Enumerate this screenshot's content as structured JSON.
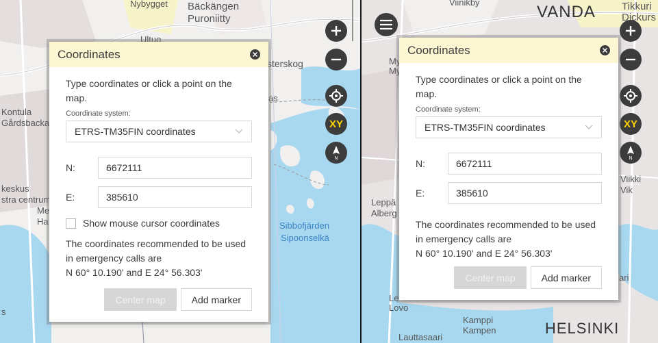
{
  "map_left": {
    "labels": [
      {
        "text": "Nybygget",
        "name": "map-label-nybygget"
      },
      {
        "text": "Bäckängen",
        "name": "map-label-backangen"
      },
      {
        "text": "Puroniitty",
        "name": "map-label-puroniitty"
      },
      {
        "text": "Ultuo",
        "name": "map-label-ultuo"
      },
      {
        "text": "sterskog",
        "name": "map-label-sterskog"
      },
      {
        "text": "as",
        "name": "map-label-as"
      },
      {
        "text": "Kontula",
        "name": "map-label-kontula"
      },
      {
        "text": "Gårdsbacka",
        "name": "map-label-gardsbacka"
      },
      {
        "text": "keskus",
        "name": "map-label-keskus"
      },
      {
        "text": "stra centrum",
        "name": "map-label-stra-centrum"
      },
      {
        "text": "Me",
        "name": "map-label-me"
      },
      {
        "text": "Ha",
        "name": "map-label-ha"
      },
      {
        "text": "Sibbofjärden",
        "name": "map-label-sibbofjarden"
      },
      {
        "text": "Sipoonselkä",
        "name": "map-label-sipoonselka"
      },
      {
        "text": "s",
        "name": "map-label-s"
      }
    ]
  },
  "map_right": {
    "labels": [
      {
        "text": "Viinikby",
        "name": "map-label-viinikby"
      },
      {
        "text": "VANDA",
        "name": "map-label-vanda"
      },
      {
        "text": "Tikkuri",
        "name": "map-label-tikkuri"
      },
      {
        "text": "Dickurs",
        "name": "map-label-dickurs"
      },
      {
        "text": "My",
        "name": "map-label-my"
      },
      {
        "text": "My",
        "name": "map-label-my-2"
      },
      {
        "text": "Leppä",
        "name": "map-label-leppa"
      },
      {
        "text": "Alberg",
        "name": "map-label-alberg"
      },
      {
        "text": "Viikki",
        "name": "map-label-viikki"
      },
      {
        "text": "Vik",
        "name": "map-label-vik"
      },
      {
        "text": "Le",
        "name": "map-label-le"
      },
      {
        "text": "Lovo",
        "name": "map-label-lovo"
      },
      {
        "text": "Kamppi",
        "name": "map-label-kamppi"
      },
      {
        "text": "Kampen",
        "name": "map-label-kampen"
      },
      {
        "text": "Lauttasaari",
        "name": "map-label-lauttasaari"
      },
      {
        "text": "HELSINKI",
        "name": "map-label-helsinki"
      },
      {
        "text": "ari",
        "name": "map-label-ari"
      }
    ]
  },
  "controls": {
    "zoom_in_label": "+",
    "zoom_out_label": "−",
    "xy_label": "XY",
    "compass_label": "N"
  },
  "popup": {
    "title": "Coordinates",
    "intro": "Type coordinates or click a point on the map.",
    "system_label": "Coordinate system:",
    "system_value": "ETRS-TM35FIN coordinates",
    "n_label": "N:",
    "n_value": "6672111",
    "e_label": "E:",
    "e_value": "385610",
    "show_cursor_label": "Show mouse cursor coordinates",
    "info_line1": "The coordinates recommended to be used",
    "info_line2": "in emergency calls are",
    "info_line3": "N 60° 10.190' and E 24° 56.303'",
    "center_button": "Center map",
    "marker_button": "Add marker"
  },
  "colors": {
    "header_bg": "#fdf6d3",
    "water": "#a8d8f0",
    "land": "#f1f0ee",
    "urban": "#e2dcdc",
    "xy_yellow": "#ffd400",
    "control_dark": "#3c3c3c"
  }
}
